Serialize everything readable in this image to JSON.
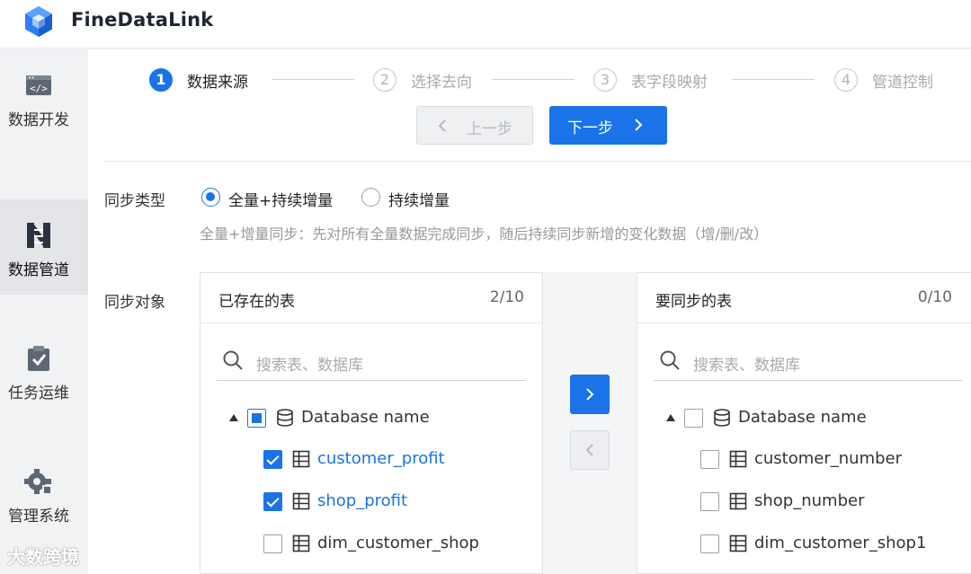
{
  "app": {
    "title": "FineDataLink"
  },
  "sidebar": {
    "items": [
      {
        "label": "数据开发",
        "icon": "code-icon"
      },
      {
        "label": "数据管道",
        "icon": "pipeline-icon",
        "active": true
      },
      {
        "label": "任务运维",
        "icon": "task-check-icon"
      },
      {
        "label": "管理系统",
        "icon": "gear-icon"
      }
    ]
  },
  "steps": [
    {
      "num": "1",
      "label": "数据来源",
      "active": true
    },
    {
      "num": "2",
      "label": "选择去向"
    },
    {
      "num": "3",
      "label": "表字段映射"
    },
    {
      "num": "4",
      "label": "管道控制"
    }
  ],
  "nav": {
    "prev_label": "上一步",
    "next_label": "下一步"
  },
  "sync_type": {
    "label": "同步类型",
    "options": [
      {
        "label": "全量+持续增量",
        "selected": true
      },
      {
        "label": "持续增量",
        "selected": false
      }
    ],
    "hint": "全量+增量同步：先对所有全量数据完成同步，随后持续同步新增的变化数据（增/删/改）"
  },
  "sync_object": {
    "label": "同步对象",
    "source": {
      "title": "已存在的表",
      "count": "2/10",
      "search_placeholder": "搜索表、数据库",
      "db_name": "Database name",
      "tables": [
        {
          "name": "customer_profit",
          "checked": true
        },
        {
          "name": "shop_profit",
          "checked": true
        },
        {
          "name": "dim_customer_shop",
          "checked": false
        }
      ]
    },
    "target": {
      "title": "要同步的表",
      "count": "0/10",
      "search_placeholder": "搜索表、数据库",
      "db_name": "Database name",
      "tables": [
        {
          "name": "customer_number",
          "checked": false
        },
        {
          "name": "shop_number",
          "checked": false
        },
        {
          "name": "dim_customer_shop1",
          "checked": false
        }
      ]
    }
  },
  "watermark": "大数跨境",
  "colors": {
    "accent": "#1a73e8",
    "sidebar_bg": "#f1f2f4"
  }
}
